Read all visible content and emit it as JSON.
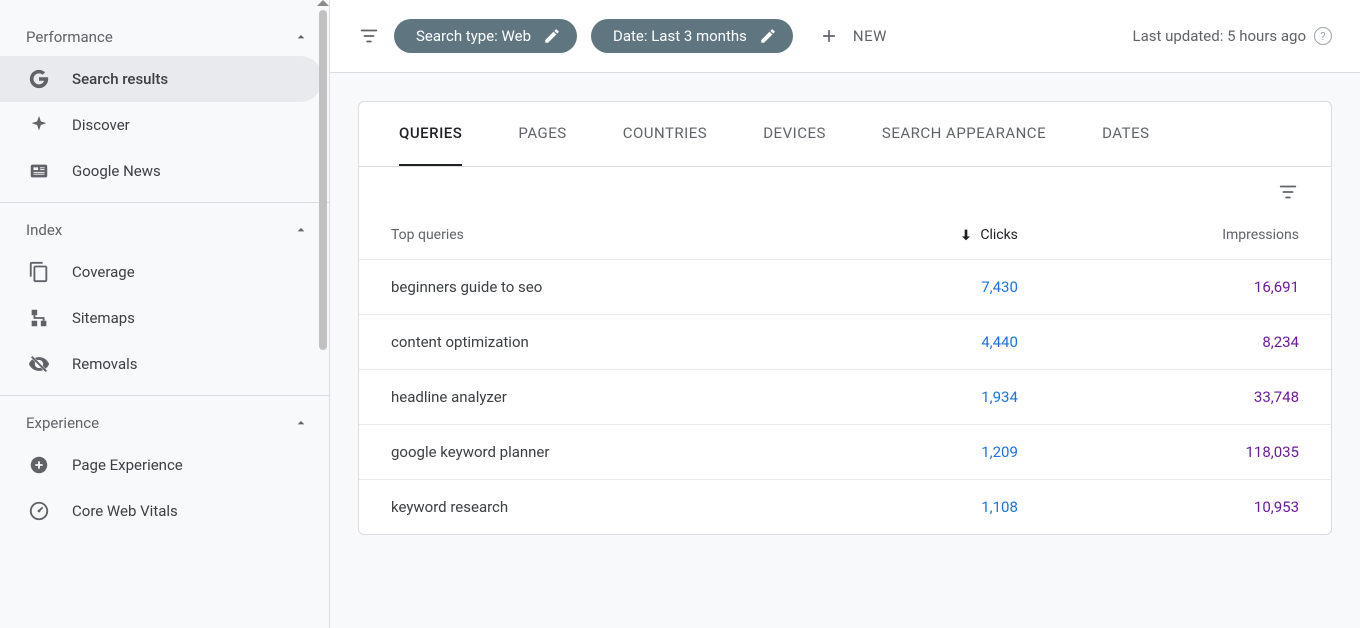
{
  "sidebar": {
    "sections": [
      {
        "title": "Performance",
        "items": [
          {
            "label": "Search results",
            "icon": "google-icon",
            "active": true
          },
          {
            "label": "Discover",
            "icon": "sparkle-icon"
          },
          {
            "label": "Google News",
            "icon": "news-icon"
          }
        ]
      },
      {
        "title": "Index",
        "items": [
          {
            "label": "Coverage",
            "icon": "pages-icon"
          },
          {
            "label": "Sitemaps",
            "icon": "sitemap-icon"
          },
          {
            "label": "Removals",
            "icon": "removal-icon"
          }
        ]
      },
      {
        "title": "Experience",
        "items": [
          {
            "label": "Page Experience",
            "icon": "circle-plus-icon"
          },
          {
            "label": "Core Web Vitals",
            "icon": "vitals-icon"
          }
        ]
      }
    ]
  },
  "toolbar": {
    "search_type_chip": "Search type: Web",
    "date_chip": "Date: Last 3 months",
    "new_label": "NEW",
    "last_updated": "Last updated: 5 hours ago"
  },
  "tabs": [
    "QUERIES",
    "PAGES",
    "COUNTRIES",
    "DEVICES",
    "SEARCH APPEARANCE",
    "DATES"
  ],
  "active_tab": 0,
  "table": {
    "headers": {
      "query": "Top queries",
      "clicks": "Clicks",
      "impressions": "Impressions"
    },
    "rows": [
      {
        "query": "beginners guide to seo",
        "clicks": "7,430",
        "impressions": "16,691"
      },
      {
        "query": "content optimization",
        "clicks": "4,440",
        "impressions": "8,234"
      },
      {
        "query": "headline analyzer",
        "clicks": "1,934",
        "impressions": "33,748"
      },
      {
        "query": "google keyword planner",
        "clicks": "1,209",
        "impressions": "118,035"
      },
      {
        "query": "keyword research",
        "clicks": "1,108",
        "impressions": "10,953"
      }
    ]
  }
}
